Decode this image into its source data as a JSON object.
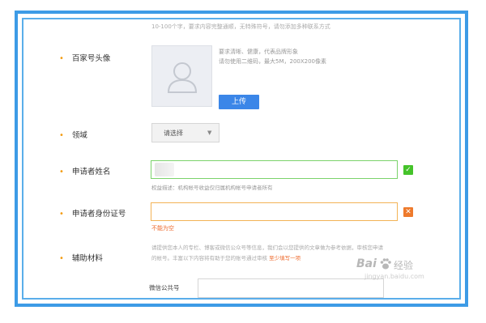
{
  "form": {
    "top_hint": "10-100个字，要求内容完整通顺，无特殊符号，请勿添加多种联系方式",
    "avatar": {
      "label": "百家号头像",
      "note_line1": "要求清晰、健康，代表品牌形象",
      "note_line2": "请勿使用二维码，最大5M，200X200像素",
      "upload_label": "上传"
    },
    "domain": {
      "label": "领域",
      "selected": "请选择"
    },
    "applicant_name": {
      "label": "申请者姓名",
      "value": "",
      "hint": "权益描述：机构帐号收益仅归属机构帐号申请者所有",
      "status": "valid"
    },
    "applicant_id": {
      "label": "申请者身份证号",
      "value": "",
      "error": "不能为空",
      "status": "error"
    },
    "materials": {
      "label": "辅助材料",
      "desc_line1": "请提供您本人的专栏、博客或微信公众号等信息，我们会以您提供的文章做为参考依据，审核您申请",
      "desc_line2": "的帐号。丰富以下内容将有助于您的账号通过审核",
      "desc_link": "至少填写一项",
      "wechat_label": "微信公共号",
      "wechat_value": ""
    }
  },
  "watermark": {
    "brand": "Bai",
    "brand_cn": "经验",
    "site": "jingyan.baidu.com"
  },
  "colors": {
    "frame": "#3d9be6",
    "bullet": "#f39c12",
    "primary_button": "#3b86e8",
    "valid": "#45c32a",
    "error": "#ee7a2c"
  }
}
